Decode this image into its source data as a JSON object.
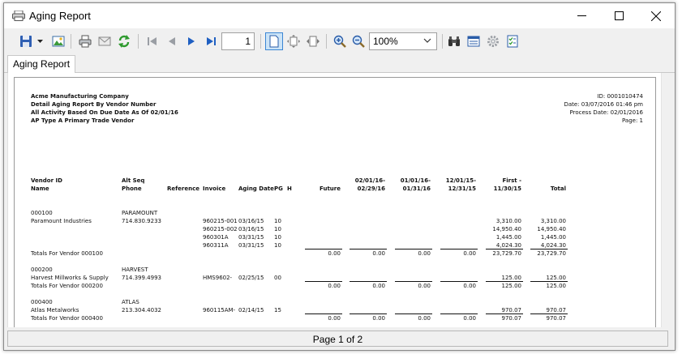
{
  "window": {
    "title": "Aging Report"
  },
  "toolbar": {
    "page_number": "1",
    "zoom": "100%"
  },
  "tabs": [
    {
      "label": "Aging Report"
    }
  ],
  "report": {
    "company": "Acme Manufacturing Company",
    "line2": "Detail Aging Report By Vendor Number",
    "line3": "All Activity Based On Due Date As Of 02/01/16",
    "line4": "AP Type A Primary Trade Vendor",
    "id": "ID: 0001010474",
    "date": "Date: 03/07/2016 01:46 pm",
    "process_date": "Process Date: 02/01/2016",
    "page": "Page: 1",
    "headers": {
      "vendor_id": "Vendor ID",
      "name": "Name",
      "alt_seq": "Alt Seq",
      "phone": "Phone",
      "reference": "Reference",
      "invoice": "Invoice",
      "aging_date": "Aging Date",
      "pg": "PG",
      "h": "H",
      "future": "Future",
      "p1a": "02/01/16-",
      "p1b": "02/29/16",
      "p2a": "01/01/16-",
      "p2b": "01/31/16",
      "p3a": "12/01/15-",
      "p3b": "12/31/15",
      "p4a": "First -",
      "p4b": "11/30/15",
      "total": "Total"
    },
    "v1": {
      "id": "000100",
      "alt": "PARAMOUNT",
      "name": "Paramount Industries",
      "phone": "714.830.9233",
      "rows": [
        {
          "invoice": "960215-001",
          "date": "03/16/15",
          "pg": "10",
          "first": "3,310.00",
          "total": "3,310.00"
        },
        {
          "invoice": "960215-002",
          "date": "03/16/15",
          "pg": "10",
          "first": "14,950.40",
          "total": "14,950.40"
        },
        {
          "invoice": "960301A",
          "date": "03/31/15",
          "pg": "10",
          "first": "1,445.00",
          "total": "1,445.00"
        },
        {
          "invoice": "960311A",
          "date": "03/31/15",
          "pg": "10",
          "first": "4,024.30",
          "total": "4,024.30"
        }
      ],
      "totals_label": "Totals For Vendor 000100",
      "t_future": "0.00",
      "t_p1": "0.00",
      "t_p2": "0.00",
      "t_p3": "0.00",
      "t_first": "23,729.70",
      "t_total": "23,729.70"
    },
    "v2": {
      "id": "000200",
      "alt": "HARVEST",
      "name": "Harvest Millworks & Supply",
      "phone": "714.399.4993",
      "invoice": "HMS9602-",
      "date": "02/25/15",
      "pg": "00",
      "first": "125.00",
      "total": "125.00",
      "totals_label": "Totals For Vendor 000200",
      "t_future": "0.00",
      "t_p1": "0.00",
      "t_p2": "0.00",
      "t_p3": "0.00",
      "t_first": "125.00",
      "t_total": "125.00"
    },
    "v3": {
      "id": "000400",
      "alt": "ATLAS",
      "name": "Atlas Metalworks",
      "phone": "213.304.4032",
      "invoice": "960115AM-",
      "date": "02/14/15",
      "pg": "15",
      "first": "970.07",
      "total": "970.07",
      "totals_label": "Totals For Vendor 000400",
      "t_future": "0.00",
      "t_p1": "0.00",
      "t_p2": "0.00",
      "t_p3": "0.00",
      "t_first": "970.07",
      "t_total": "970.07"
    }
  },
  "status": {
    "text": "Page 1 of 2"
  }
}
